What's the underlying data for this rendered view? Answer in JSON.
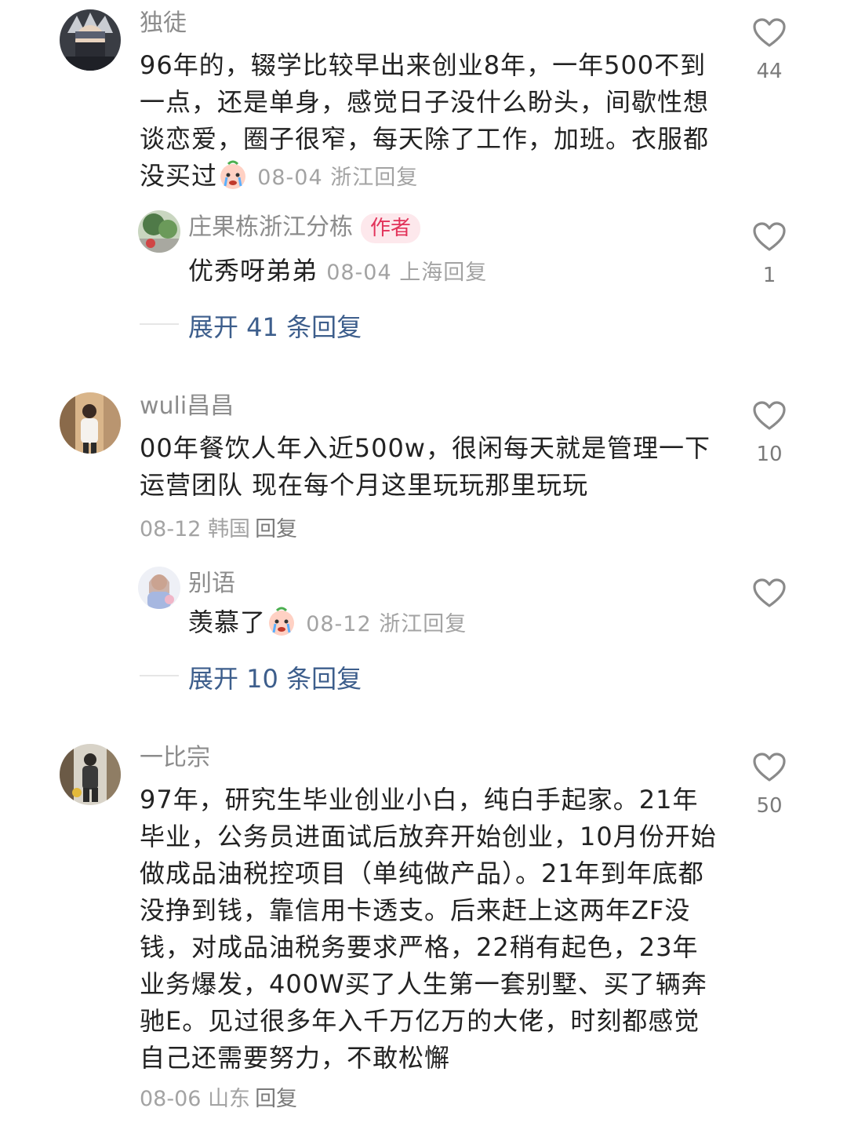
{
  "comments": [
    {
      "username": "独徒",
      "text": "96年的，辍学比较早出来创业8年，一年500不到一点，还是单身，感觉日子没什么盼头，间歇性想谈恋爱，圈子很窄，每天除了工作，加班。衣服都没买过",
      "date": "08-04",
      "location": "浙江",
      "reply_label": "回复",
      "likes": "44",
      "sub_reply": {
        "username": "庄果栋浙江分栋",
        "badge": "作者",
        "text": "优秀呀弟弟",
        "date": "08-04",
        "location": "上海",
        "reply_label": "回复",
        "likes": "1"
      },
      "expand_label": "展开 41 条回复"
    },
    {
      "username": "wuli昌昌",
      "text": "00年餐饮人年入近500w，很闲每天就是管理一下运营团队 现在每个月这里玩玩那里玩玩",
      "date": "08-12",
      "location": "韩国",
      "reply_label": "回复",
      "likes": "10",
      "sub_reply": {
        "username": "别语",
        "text": "羡慕了",
        "date": "08-12",
        "location": "浙江",
        "reply_label": "回复",
        "likes": ""
      },
      "expand_label": "展开 10 条回复"
    },
    {
      "username": "一比宗",
      "text": "97年，研究生毕业创业小白，纯白手起家。21年毕业，公务员进面试后放弃开始创业，10月份开始做成品油税控项目（单纯做产品）。21年到年底都没挣到钱，靠信用卡透支。后来赶上这两年ZF没钱，对成品油税务要求严格，22稍有起色，23年业务爆发，400W买了人生第一套别墅、买了辆奔驰E。见过很多年入千万亿万的大佬，时刻都感觉自己还需要努力，不敢松懈",
      "date": "08-06",
      "location": "山东",
      "reply_label": "回复",
      "likes": "50"
    }
  ],
  "icons": {
    "like": "heart-outline-icon",
    "emoji_cry": "crying-emoji-icon"
  },
  "colors": {
    "link": "#3d5e8c",
    "badge_bg": "#fde8ec",
    "badge_text": "#e2335a"
  }
}
